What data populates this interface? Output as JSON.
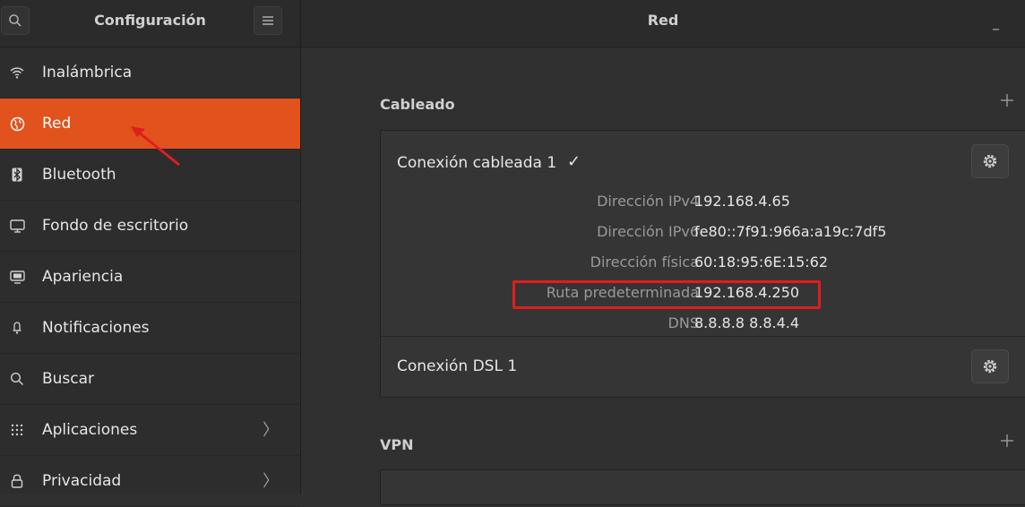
{
  "header": {
    "app_title": "Configuración",
    "page_title": "Red",
    "search_icon": "search-icon",
    "menu_icon": "hamburger-menu-icon",
    "minimize_label": "–"
  },
  "sidebar": {
    "items": [
      {
        "label": "Inalámbrica",
        "icon": "wifi-icon",
        "active": false,
        "chevron": false
      },
      {
        "label": "Red",
        "icon": "globe-icon",
        "active": true,
        "chevron": false
      },
      {
        "label": "Bluetooth",
        "icon": "bluetooth-icon",
        "active": false,
        "chevron": false
      },
      {
        "label": "Fondo de escritorio",
        "icon": "monitor-icon",
        "active": false,
        "chevron": false
      },
      {
        "label": "Apariencia",
        "icon": "appearance-icon",
        "active": false,
        "chevron": false
      },
      {
        "label": "Notificaciones",
        "icon": "bell-icon",
        "active": false,
        "chevron": false
      },
      {
        "label": "Buscar",
        "icon": "search-icon",
        "active": false,
        "chevron": false
      },
      {
        "label": "Aplicaciones",
        "icon": "apps-grid-icon",
        "active": false,
        "chevron": true
      },
      {
        "label": "Privacidad",
        "icon": "lock-icon",
        "active": false,
        "chevron": true
      }
    ]
  },
  "wired": {
    "section_title": "Cableado",
    "connection_name": "Conexión cableada 1",
    "connected_check": "✓",
    "details": [
      {
        "label": "Dirección IPv4",
        "value": "192.168.4.65"
      },
      {
        "label": "Dirección IPv6",
        "value": "fe80::7f91:966a:a19c:7df5"
      },
      {
        "label": "Dirección física",
        "value": "60:18:95:6E:15:62"
      },
      {
        "label": "Ruta predeterminada",
        "value": "192.168.4.250"
      },
      {
        "label": "DNS",
        "value": "8.8.8.8 8.8.4.4"
      }
    ],
    "dsl_name": "Conexión DSL 1"
  },
  "vpn": {
    "section_title": "VPN"
  },
  "colors": {
    "accent": "#e1521c",
    "highlight_box": "#e01e1e",
    "annotation_arrow": "#e01e1e"
  }
}
